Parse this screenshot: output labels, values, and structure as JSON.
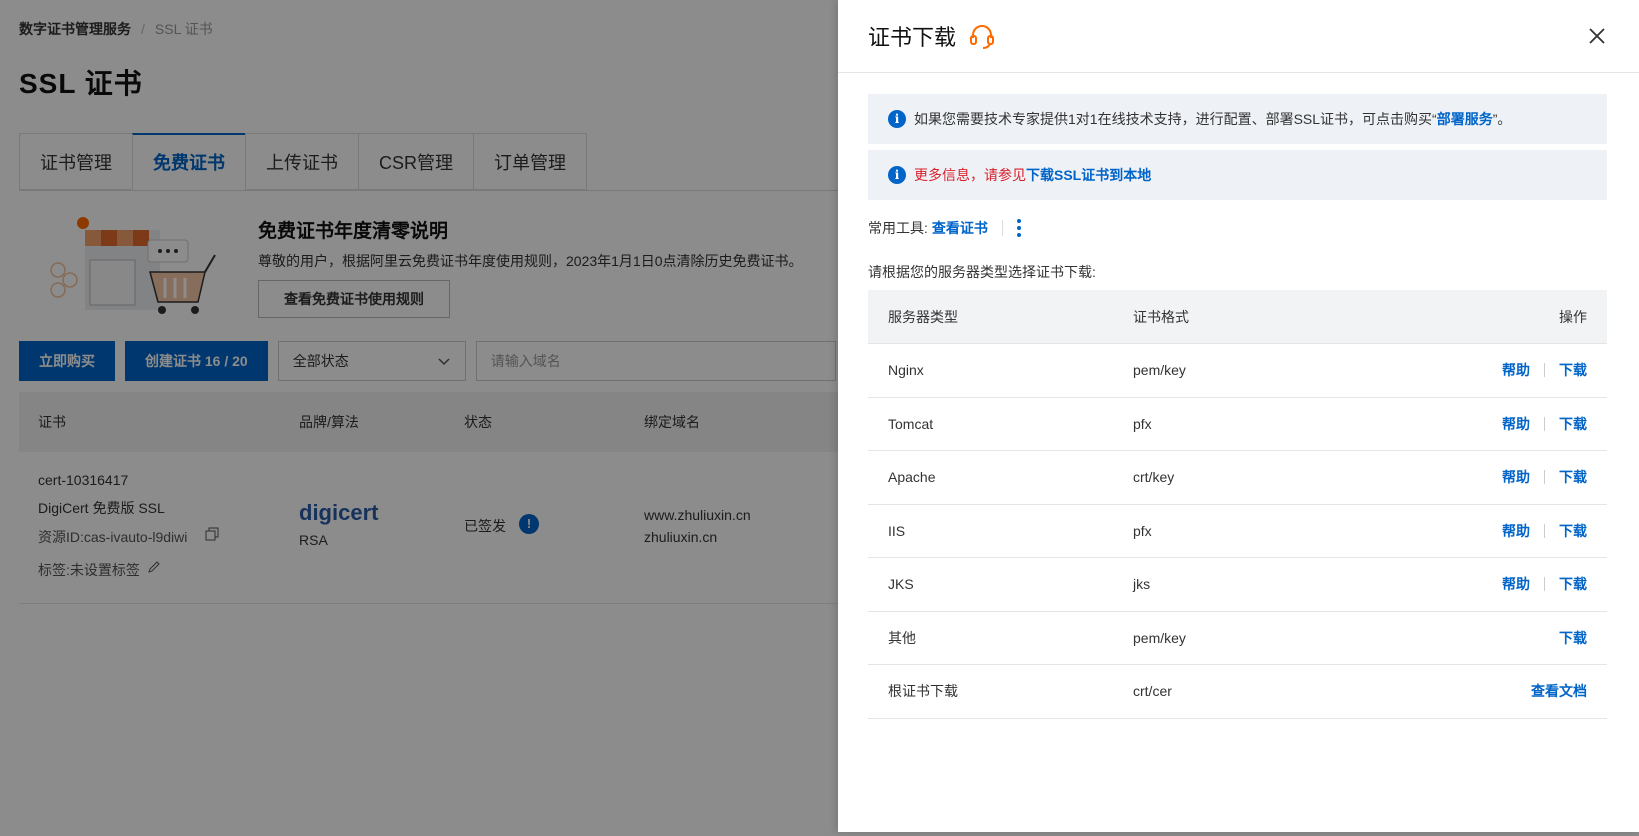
{
  "breadcrumb": {
    "root": "数字证书管理服务",
    "sep": "/",
    "current": "SSL 证书"
  },
  "page_title": "SSL 证书",
  "tabs": [
    {
      "label": "证书管理"
    },
    {
      "label": "免费证书"
    },
    {
      "label": "上传证书"
    },
    {
      "label": "CSR管理"
    },
    {
      "label": "订单管理"
    }
  ],
  "notice": {
    "title": "免费证书年度清零说明",
    "text": "尊敬的用户，根据阿里云免费证书年度使用规则，2023年1月1日0点清除历史免费证书。",
    "button": "查看免费证书使用规则"
  },
  "toolbar": {
    "buy": "立即购买",
    "create": "创建证书 16 / 20",
    "status_select": "全部状态",
    "search_placeholder": "请输入域名"
  },
  "list": {
    "headers": [
      "证书",
      "品牌/算法",
      "状态",
      "绑定域名"
    ],
    "row": {
      "cert_id": "cert-10316417",
      "cert_name": "DigiCert 免费版 SSL",
      "resource_id": "资源ID:cas-ivauto-l9diwi",
      "tags": "标签:未设置标签",
      "brand": "digicert",
      "algorithm": "RSA",
      "status": "已签发",
      "domain1": "www.zhuliuxin.cn",
      "domain2": "zhuliuxin.cn"
    }
  },
  "drawer": {
    "title": "证书下载",
    "alert1": {
      "text": "如果您需要技术专家提供1对1在线技术支持，进行配置、部署SSL证书，可点击购买“",
      "link": "部署服务",
      "tail": "”。"
    },
    "alert2": {
      "text": "更多信息，请参见",
      "link": "下载SSL证书到本地"
    },
    "tools_label": "常用工具:",
    "tools_link": "查看证书",
    "hint": "请根据您的服务器类型选择证书下载:",
    "table": {
      "headers": {
        "server": "服务器类型",
        "format": "证书格式",
        "action": "操作"
      },
      "rows": [
        {
          "server": "Nginx",
          "format": "pem/key",
          "help": "帮助",
          "download": "下载"
        },
        {
          "server": "Tomcat",
          "format": "pfx",
          "help": "帮助",
          "download": "下载"
        },
        {
          "server": "Apache",
          "format": "crt/key",
          "help": "帮助",
          "download": "下载"
        },
        {
          "server": "IIS",
          "format": "pfx",
          "help": "帮助",
          "download": "下载"
        },
        {
          "server": "JKS",
          "format": "jks",
          "help": "帮助",
          "download": "下载"
        },
        {
          "server": "其他",
          "format": "pem/key",
          "download": "下载"
        },
        {
          "server": "根证书下载",
          "format": "crt/cer",
          "doc": "查看文档"
        }
      ]
    }
  },
  "colors": {
    "primary": "#0064c8",
    "danger": "#d9202b",
    "accent": "#ff6a00"
  }
}
